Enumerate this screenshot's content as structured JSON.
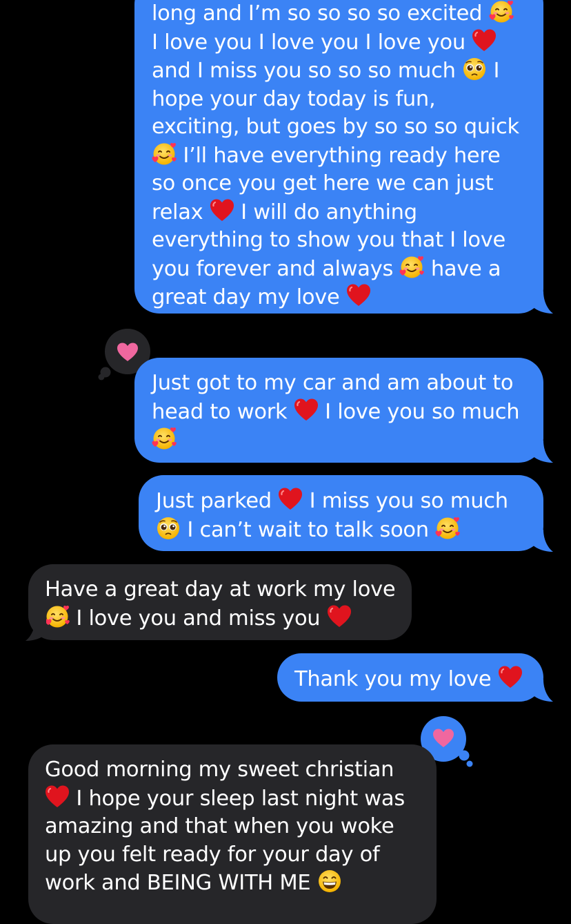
{
  "messages": [
    {
      "id": "m1",
      "direction": "sent",
      "lines": [
        {
          "t": "long and I’m so so so so excited",
          "e": "smiling-face-with-hearts"
        },
        {
          "t": "I love you I love you I love you",
          "e": "red-heart"
        },
        {
          "t": "and I miss you so so so much",
          "e": "pleading-face",
          "t2": " I"
        },
        {
          "t": "hope your day today is fun,"
        },
        {
          "t": "exciting, but goes by so so so quick"
        },
        {
          "e0": "smiling-face-with-hearts",
          "t": " I’ll have everything ready here"
        },
        {
          "t": "so once you get here we can just"
        },
        {
          "t": "relax",
          "e": "red-heart",
          "t2": " I will do anything"
        },
        {
          "t": "everything to show you that I love"
        },
        {
          "t": "you forever and always",
          "e": "smiling-face-with-hearts",
          "t2": " have a"
        },
        {
          "t": "great day my love",
          "e": "red-heart"
        }
      ]
    },
    {
      "id": "m2",
      "direction": "sent",
      "tapback": "heart",
      "lines": [
        {
          "t": "Just got to my car and am about to"
        },
        {
          "t": "head to work",
          "e": "red-heart",
          "t2": " I love you so much"
        },
        {
          "e0": "smiling-face-with-hearts"
        }
      ]
    },
    {
      "id": "m3",
      "direction": "sent",
      "lines": [
        {
          "t": "Just parked",
          "e": "red-heart",
          "t2": " I miss you so much"
        },
        {
          "e0": "pleading-face",
          "t": " I can’t wait to talk soon",
          "e": "smiling-face-with-hearts"
        }
      ]
    },
    {
      "id": "m4",
      "direction": "received",
      "lines": [
        {
          "t": "Have a great day at work my love"
        },
        {
          "e0": "smiling-face-with-hearts",
          "t": " I love you and miss you",
          "e": "red-heart"
        }
      ]
    },
    {
      "id": "m5",
      "direction": "sent",
      "lines": [
        {
          "t": "Thank you my love",
          "e": "red-heart"
        }
      ]
    },
    {
      "id": "m6",
      "direction": "received",
      "tapback": "heart",
      "lines": [
        {
          "t": "Good morning my sweet christian"
        },
        {
          "e0": "red-heart",
          "t": " I hope your sleep last night was"
        },
        {
          "t": "amazing and that when you woke"
        },
        {
          "t": "up you felt ready for your day of"
        },
        {
          "t": "work and BEING WITH ME",
          "e": "grinning-face"
        }
      ]
    }
  ],
  "colors": {
    "sent_bubble": "#3b83f5",
    "received_bubble": "#262629",
    "background": "#000000",
    "tapback_heart": "#f0679f"
  }
}
